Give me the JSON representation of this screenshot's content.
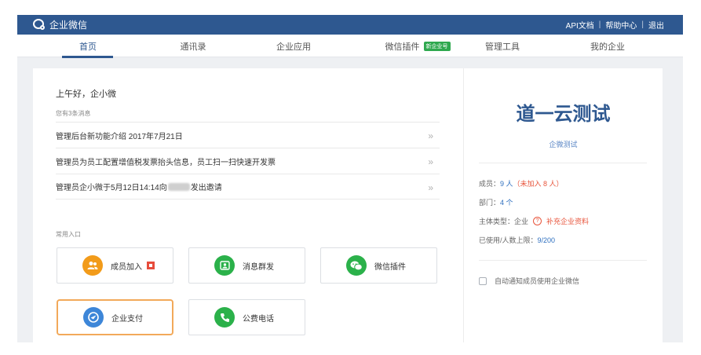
{
  "header": {
    "logo_text": "企业微信",
    "links": [
      "API文档",
      "帮助中心",
      "退出"
    ],
    "bg_color": "#2e5890"
  },
  "nav": {
    "items": [
      "首页",
      "通讯录",
      "企业应用",
      "微信插件",
      "管理工具",
      "我的企业"
    ],
    "badge": "新企业号",
    "active_index": 0
  },
  "home": {
    "greeting": "上午好，企小微",
    "message_count": "您有3条消息",
    "messages": [
      "管理后台新功能介绍 2017年7月21日",
      "管理员为员工配置增值税发票抬头信息，员工扫一扫快速开发票",
      "管理员企小微于5月12日14:14向"
    ],
    "message3_suffix": "发出邀请",
    "chevron": "»",
    "shortcuts_label": "常用入口",
    "shortcuts": [
      {
        "label": "成员加入",
        "icon": "members-icon",
        "color": "#f29b1a"
      },
      {
        "label": "消息群发",
        "icon": "message-icon",
        "color": "#2bb14a"
      },
      {
        "label": "微信插件",
        "icon": "wechat-icon",
        "color": "#2bb14a"
      },
      {
        "label": "企业支付",
        "icon": "payment-icon",
        "color": "#3d86d8"
      },
      {
        "label": "公费电话",
        "icon": "phone-icon",
        "color": "#2bb14a"
      }
    ]
  },
  "company": {
    "name": "道一云测试",
    "subname": "企微测试",
    "members_label": "成员：",
    "members_value": "9 人",
    "not_joined": "（未加入 8 人）",
    "departments_label": "部门：",
    "departments_value": "4 个",
    "type_label": "主体类型：企业",
    "supplement_link": "补充企业资料",
    "usage_label": "已使用/人数上限：",
    "usage_value": "9/200",
    "auto_notify_label": "自动通知成员使用企业微信"
  }
}
